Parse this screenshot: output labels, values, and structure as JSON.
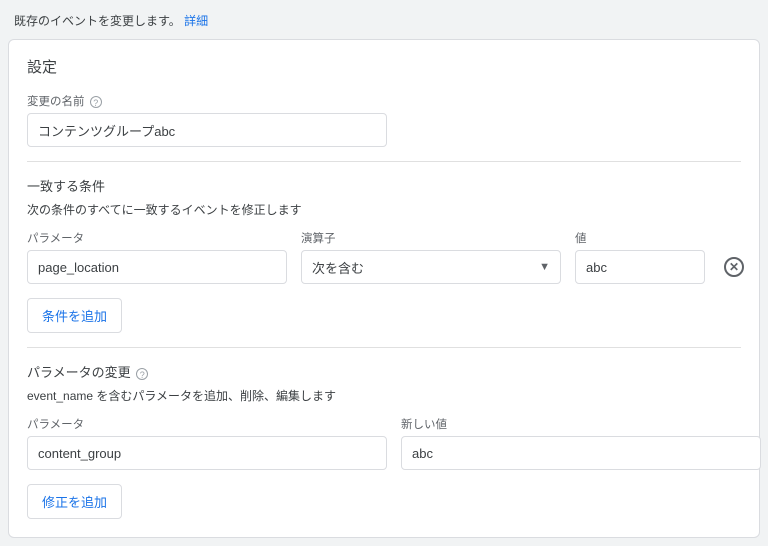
{
  "intro": {
    "text": "既存のイベントを変更します。",
    "link_label": "詳細"
  },
  "card_title": "設定",
  "name_section": {
    "label": "変更の名前",
    "value": "コンテンツグループabc"
  },
  "conditions_section": {
    "title": "一致する条件",
    "subtitle": "次の条件のすべてに一致するイベントを修正します",
    "labels": {
      "parameter": "パラメータ",
      "operator": "演算子",
      "value": "値"
    },
    "row": {
      "parameter": "page_location",
      "operator": "次を含む",
      "value": "abc"
    },
    "add_button": "条件を追加"
  },
  "params_section": {
    "title": "パラメータの変更",
    "subtitle": "event_name を含むパラメータを追加、削除、編集します",
    "labels": {
      "parameter": "パラメータ",
      "new_value": "新しい値"
    },
    "row": {
      "parameter": "content_group",
      "new_value": "abc"
    },
    "add_button": "修正を追加"
  }
}
